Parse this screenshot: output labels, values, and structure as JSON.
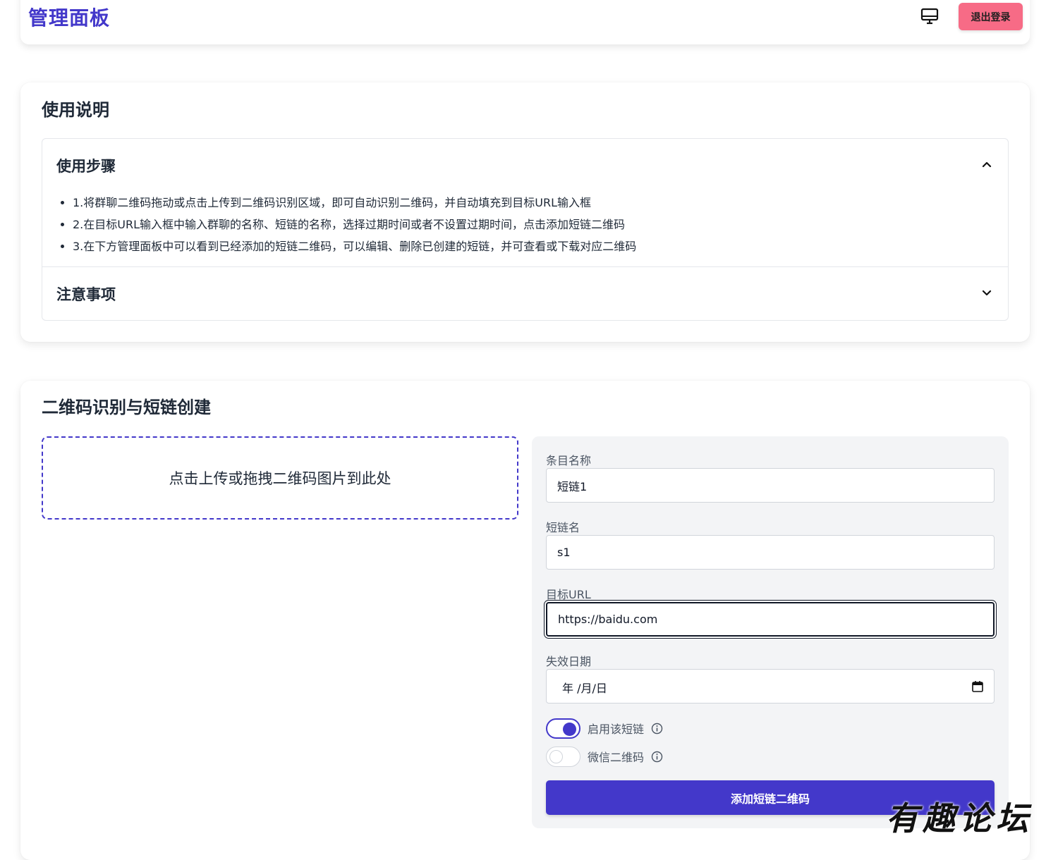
{
  "header": {
    "title": "管理面板",
    "monitor_icon": "monitor-icon",
    "logout_label": "退出登录"
  },
  "instructions": {
    "title": "使用说明",
    "steps_section": {
      "title": "使用步骤",
      "expanded": true,
      "items": [
        "1.将群聊二维码拖动或点击上传到二维码识别区域，即可自动识别二维码，并自动填充到目标URL输入框",
        "2.在目标URL输入框中输入群聊的名称、短链的名称，选择过期时间或者不设置过期时间，点击添加短链二维码",
        "3.在下方管理面板中可以看到已经添加的短链二维码，可以编辑、删除已创建的短链，并可查看或下载对应二维码"
      ]
    },
    "notes_section": {
      "title": "注意事项",
      "expanded": false
    }
  },
  "qr_section": {
    "title": "二维码识别与短链创建",
    "dropzone_text": "点击上传或拖拽二维码图片到此处",
    "form": {
      "name_label": "条目名称",
      "name_value": "短链1",
      "short_label": "短链名",
      "short_value": "s1",
      "url_label": "目标URL",
      "url_value": "https://baidu.com",
      "expiry_label": "失效日期",
      "expiry_placeholder": "年 /月/日",
      "enable_label": "启用该短链",
      "enable_on": true,
      "wechat_label": "微信二维码",
      "wechat_on": false,
      "submit_label": "添加短链二维码"
    }
  },
  "watermark": "有趣论坛",
  "colors": {
    "accent": "#4338ca",
    "logout": "#f76b86"
  }
}
